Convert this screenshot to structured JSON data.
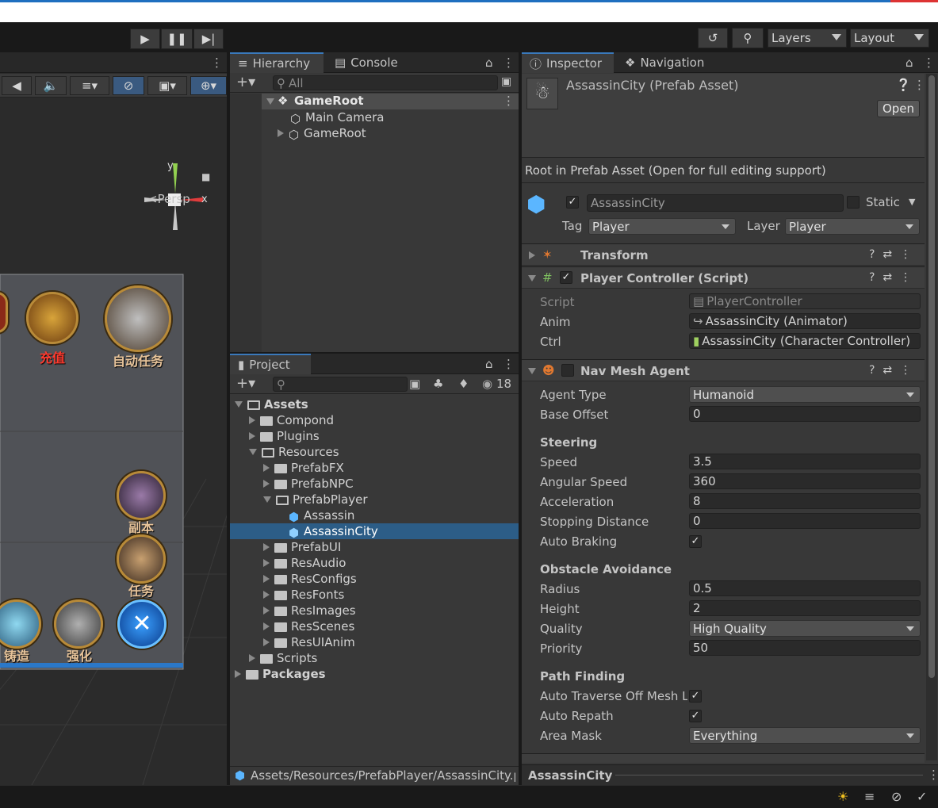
{
  "toolbar": {
    "play_icon": "play-icon",
    "pause_icon": "pause-icon",
    "step_icon": "step-icon",
    "layers_label": "Layers",
    "layout_label": "Layout"
  },
  "scene": {
    "axis_y": "y",
    "axis_x": "x",
    "persp_label": "<Persp",
    "game_labels": {
      "recharge": "充值",
      "auto_task": "自动任务",
      "dungeon": "副本",
      "task": "任务",
      "forge": "铸造",
      "strengthen": "强化"
    }
  },
  "hierarchy": {
    "tab_hierarchy": "Hierarchy",
    "tab_console": "Console",
    "search_placeholder": "All",
    "items": [
      {
        "label": "GameRoot"
      },
      {
        "label": "Main Camera"
      },
      {
        "label": "GameRoot"
      }
    ]
  },
  "project": {
    "tab_label": "Project",
    "search_value": "",
    "hidden_count": "18",
    "tree": [
      {
        "label": "Assets"
      },
      {
        "label": "Compond"
      },
      {
        "label": "Plugins"
      },
      {
        "label": "Resources"
      },
      {
        "label": "PrefabFX"
      },
      {
        "label": "PrefabNPC"
      },
      {
        "label": "PrefabPlayer"
      },
      {
        "label": "Assassin"
      },
      {
        "label": "AssassinCity"
      },
      {
        "label": "PrefabUI"
      },
      {
        "label": "ResAudio"
      },
      {
        "label": "ResConfigs"
      },
      {
        "label": "ResFonts"
      },
      {
        "label": "ResImages"
      },
      {
        "label": "ResScenes"
      },
      {
        "label": "ResUIAnim"
      },
      {
        "label": "Scripts"
      },
      {
        "label": "Packages"
      }
    ],
    "path": "Assets/Resources/PrefabPlayer/AssassinCity.p"
  },
  "inspector": {
    "tab_inspector": "Inspector",
    "tab_navigation": "Navigation",
    "asset_title": "AssassinCity (Prefab Asset)",
    "open_button": "Open",
    "notice": "Root in Prefab Asset (Open for full editing support)",
    "object_name": "AssassinCity",
    "static_label": "Static",
    "tag_label": "Tag",
    "tag_value": "Player",
    "layer_label": "Layer",
    "layer_value": "Player",
    "transform": {
      "title": "Transform"
    },
    "player_controller": {
      "title": "Player Controller (Script)",
      "script_label": "Script",
      "script_value": "PlayerController",
      "anim_label": "Anim",
      "anim_value": "AssassinCity (Animator)",
      "ctrl_label": "Ctrl",
      "ctrl_value": "AssassinCity (Character Controller)"
    },
    "nav_mesh_agent": {
      "title": "Nav Mesh Agent",
      "agent_type_label": "Agent Type",
      "agent_type_value": "Humanoid",
      "base_offset_label": "Base Offset",
      "base_offset_value": "0",
      "steering_header": "Steering",
      "speed_label": "Speed",
      "speed_value": "3.5",
      "angular_speed_label": "Angular Speed",
      "angular_speed_value": "360",
      "acceleration_label": "Acceleration",
      "acceleration_value": "8",
      "stopping_distance_label": "Stopping Distance",
      "stopping_distance_value": "0",
      "auto_braking_label": "Auto Braking",
      "obstacle_header": "Obstacle Avoidance",
      "radius_label": "Radius",
      "radius_value": "0.5",
      "height_label": "Height",
      "height_value": "2",
      "quality_label": "Quality",
      "quality_value": "High Quality",
      "priority_label": "Priority",
      "priority_value": "50",
      "path_finding_header": "Path Finding",
      "auto_traverse_label": "Auto Traverse Off Mesh Li",
      "auto_repath_label": "Auto Repath",
      "area_mask_label": "Area Mask",
      "area_mask_value": "Everything"
    },
    "footer_name": "AssassinCity"
  },
  "colors": {
    "accent": "#3a79bb",
    "selection": "#2c5d87",
    "panel": "#383838",
    "recharge_red": "#ff3b2f"
  }
}
